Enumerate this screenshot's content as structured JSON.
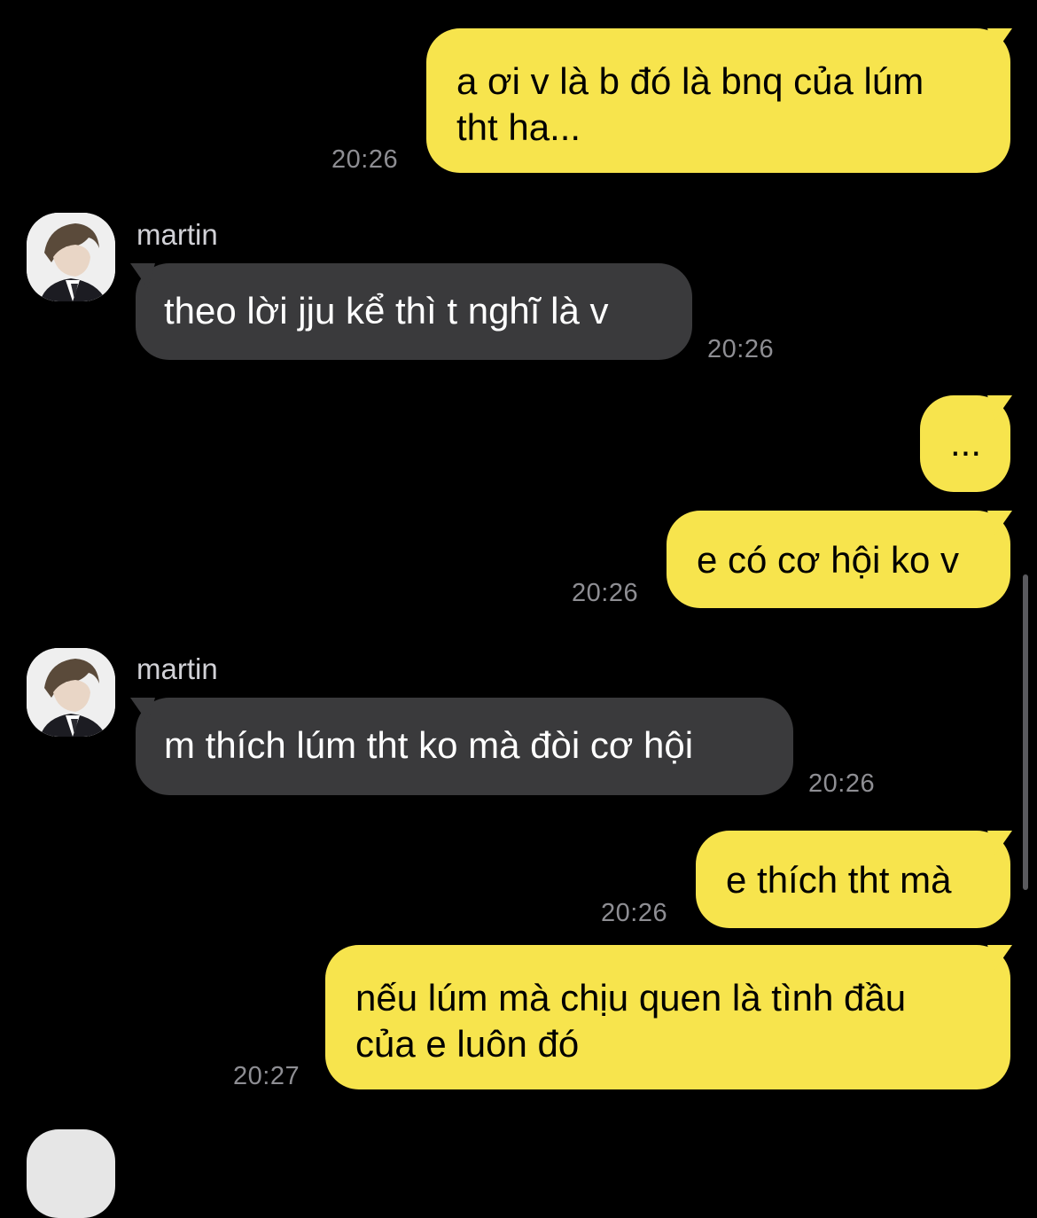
{
  "messages": [
    {
      "id": "m1",
      "direction": "outgoing",
      "text_lines": [
        "a ơi v là b đó là bnq của lúm",
        "tht ha..."
      ],
      "time": "20:26"
    },
    {
      "id": "m2",
      "direction": "incoming",
      "sender": "martin",
      "text": "theo lời jju kể thì t nghĩ là v",
      "time": "20:26"
    },
    {
      "id": "m3",
      "direction": "outgoing",
      "text": "...",
      "time": ""
    },
    {
      "id": "m4",
      "direction": "outgoing",
      "text": "e có cơ hội ko v",
      "time": "20:26"
    },
    {
      "id": "m5",
      "direction": "incoming",
      "sender": "martin",
      "text": "m thích lúm tht ko mà đòi cơ hội",
      "time": "20:26"
    },
    {
      "id": "m6",
      "direction": "outgoing",
      "text": "e thích tht mà",
      "time": "20:26"
    },
    {
      "id": "m7",
      "direction": "outgoing",
      "text_lines": [
        "nếu lúm mà chịu quen là tình đầu",
        "của e luôn đó"
      ],
      "time": "20:27"
    }
  ],
  "colors": {
    "background": "#000000",
    "outgoing_bubble": "#f7e44d",
    "incoming_bubble": "#3a3a3c",
    "timestamp": "#8e8e93",
    "sender_name": "#d1d1d6"
  },
  "icons": {
    "avatar": "user-avatar-photo"
  }
}
